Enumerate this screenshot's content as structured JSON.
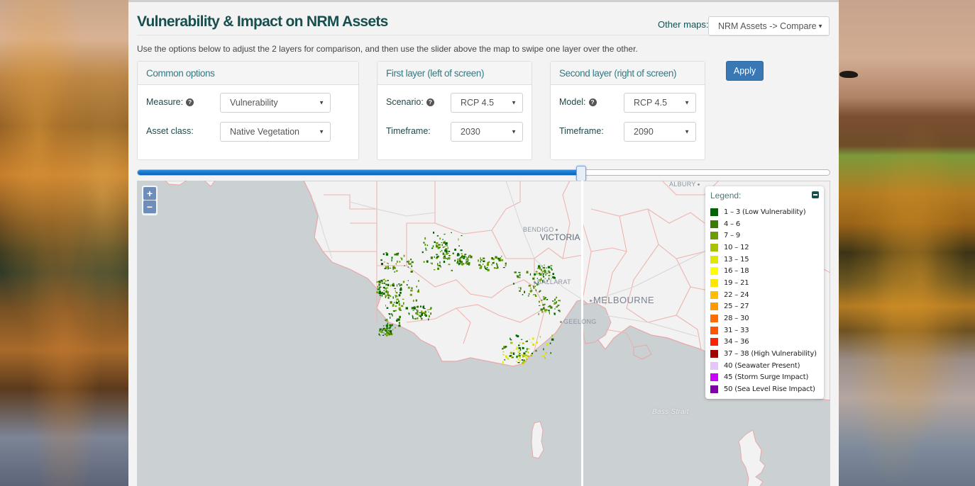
{
  "page": {
    "title": "Vulnerability & Impact on NRM Assets",
    "other_maps_label": "Other maps:",
    "other_maps_value": "NRM Assets -> Compare",
    "intro": "Use the options below to adjust the 2 layers for comparison, and then use the slider above the map to swipe one layer over the other."
  },
  "common_options": {
    "heading": "Common options",
    "measure_label": "Measure:",
    "measure_value": "Vulnerability",
    "asset_class_label": "Asset class:",
    "asset_class_value": "Native Vegetation"
  },
  "first_layer": {
    "heading": "First layer (left of screen)",
    "scenario_label": "Scenario:",
    "scenario_value": "RCP 4.5",
    "timeframe_label": "Timeframe:",
    "timeframe_value": "2030"
  },
  "second_layer": {
    "heading": "Second layer (right of screen)",
    "model_label": "Model:",
    "model_value": "RCP 4.5",
    "timeframe_label": "Timeframe:",
    "timeframe_value": "2090"
  },
  "apply_label": "Apply",
  "swipe_slider": {
    "position_fraction": 0.641
  },
  "map": {
    "zoom_in": "+",
    "zoom_out": "−",
    "labels": {
      "bendigo": "BENDIGO",
      "victoria": "VICTORIA",
      "ballarat": "BALLARAT",
      "geelong": "GEELONG",
      "melbourne": "MELBOURNE",
      "albury": "ALBURY",
      "bass_strait": "Bass Strait"
    }
  },
  "legend": {
    "title": "Legend:",
    "items": [
      {
        "label": "1 – 3  (Low Vulnerability)",
        "color": "#006400"
      },
      {
        "label": "4 – 6",
        "color": "#3a7d00"
      },
      {
        "label": "7 – 9",
        "color": "#6a9e00"
      },
      {
        "label": "10 – 12",
        "color": "#a8c400"
      },
      {
        "label": "13 – 15",
        "color": "#e0e800"
      },
      {
        "label": "16 – 18",
        "color": "#ffff00"
      },
      {
        "label": "19 – 21",
        "color": "#ffe600"
      },
      {
        "label": "22 – 24",
        "color": "#ffbf00"
      },
      {
        "label": "25 – 27",
        "color": "#ff9a00"
      },
      {
        "label": "28 – 30",
        "color": "#ff6d00"
      },
      {
        "label": "31 – 33",
        "color": "#ff5500"
      },
      {
        "label": "34 – 36",
        "color": "#ff2200"
      },
      {
        "label": "37 – 38 (High Vulnerability)",
        "color": "#a30000"
      },
      {
        "label": "40 (Seawater Present)",
        "color": "#e6c4ff"
      },
      {
        "label": "45 (Storm Surge Impact)",
        "color": "#cc00ff"
      },
      {
        "label": "50 (Sea Level Rise Impact)",
        "color": "#8000a8"
      }
    ]
  }
}
